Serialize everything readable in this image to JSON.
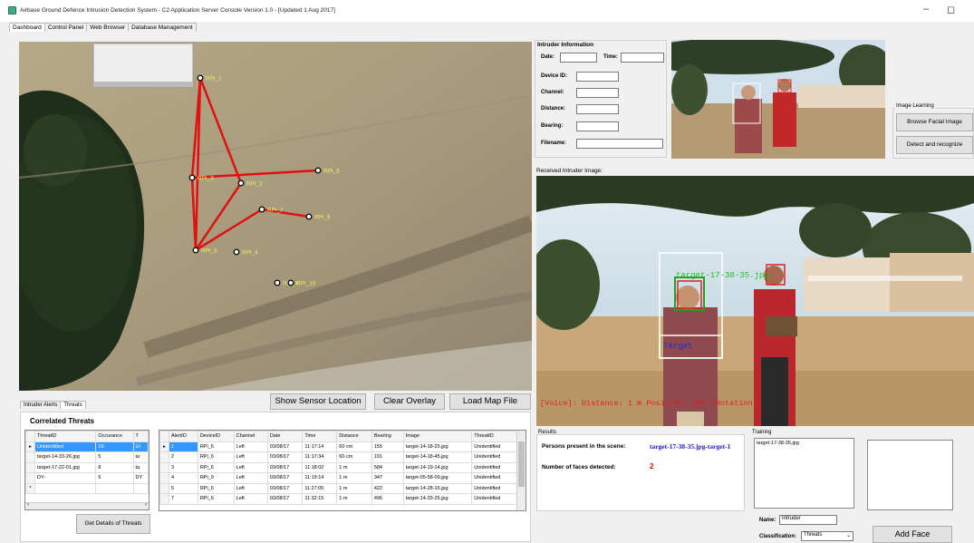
{
  "window": {
    "title": "Airbase Ground Defence Intrusion Detection System - C2 Application Server Console Version 1.0 - [Updated 1 Aug 2017]",
    "minimize": "–",
    "maximize": "◻",
    "close": "✕"
  },
  "tabs": [
    "Dashboard",
    "Control Panel",
    "Web Browser",
    "Database Management"
  ],
  "map": {
    "sensors": [
      "RPi_1",
      "RPi_2",
      "RPi_3",
      "RPi_4",
      "RPi_5",
      "RPi_6",
      "RPi_7",
      "RPi_8",
      "RPi_9",
      "RPi_10"
    ]
  },
  "map_buttons": {
    "show_sensor": "Show Sensor Location",
    "clear_overlay": "Clear Overlay",
    "load_map": "Load Map File"
  },
  "subtabs": [
    "Intruder Alerts",
    "Threats"
  ],
  "correlated": {
    "title": "Correlated Threats",
    "columns": [
      "ThreatID",
      "Occurance",
      "T"
    ],
    "rows": [
      [
        "Unidentified",
        "19",
        "Ur"
      ],
      [
        "target-14-33-26.jpg",
        "5",
        "ta"
      ],
      [
        "target-17-22-01.jpg",
        "8",
        "ta"
      ],
      [
        "DY-",
        "5",
        "DY"
      ]
    ],
    "button": "Get Details of Threats"
  },
  "alerts": {
    "columns": [
      "AlertID",
      "DeviceID",
      "Channel",
      "Date",
      "Time",
      "Distance",
      "Bearing",
      "Image",
      "ThreatID"
    ],
    "rows": [
      [
        "1",
        "RPi_6",
        "Left",
        "03/08/17",
        "11:17:14",
        "60 cm",
        "155",
        "target-14-18-25.jpg",
        "Unidentified"
      ],
      [
        "2",
        "RPi_6",
        "Left",
        "03/08/17",
        "11:17:34",
        "60 cm",
        "191",
        "target-14-18-45.jpg",
        "Unidentified"
      ],
      [
        "3",
        "RPi_6",
        "Left",
        "03/08/17",
        "11:18:02",
        "1 m",
        "584",
        "target-14-19-14.jpg",
        "Unidentified"
      ],
      [
        "4",
        "RPi_9",
        "Left",
        "03/08/17",
        "11:19:14",
        "1 m",
        "347",
        "target-05-58-09.jpg",
        "Unidentified"
      ],
      [
        "5",
        "RPi_6",
        "Left",
        "03/08/17",
        "11:27:05",
        "1 m",
        "422",
        "target-14-28-16.jpg",
        "Unidentified"
      ],
      [
        "7",
        "RPi_6",
        "Left",
        "03/08/17",
        "11:32:15",
        "1 m",
        "496",
        "target-14-33-26.jpg",
        "Unidentified"
      ]
    ]
  },
  "intruder_info": {
    "title": "Intruder Information",
    "date_label": "Date:",
    "time_label": "Time:",
    "device_label": "Device ID:",
    "channel_label": "Channel:",
    "distance_label": "Distance:",
    "bearing_label": "Bearing:",
    "filename_label": "Filename:"
  },
  "image_learning": {
    "title": "Image Learning",
    "browse": "Browse Facial Image",
    "detect": "Detect and recognize"
  },
  "received": {
    "title": "Received Intruder Image:",
    "face_label_1": "target-17-38-35.jpg",
    "target_label": "Target",
    "overlay_text": "[Voice]: Distance: 1 m Position: 560 (Rotation)"
  },
  "results": {
    "title": "Results",
    "persons_label": "Persons present in the scene:",
    "persons_value": "target-17-38-35.jpg-target-1",
    "faces_label": "Number of faces detected:",
    "faces_value": "2"
  },
  "training": {
    "title": "Training",
    "list_item": "target-17-38-35.jpg",
    "name_label": "Name:",
    "name_value": "Intruder",
    "class_label": "Classification:",
    "class_value": "Threats",
    "add_face": "Add Face"
  },
  "colors": {
    "route": "#e01010",
    "selection": "#3399ff",
    "results_value": "#1a1ae0",
    "faces_value": "#d01010"
  }
}
